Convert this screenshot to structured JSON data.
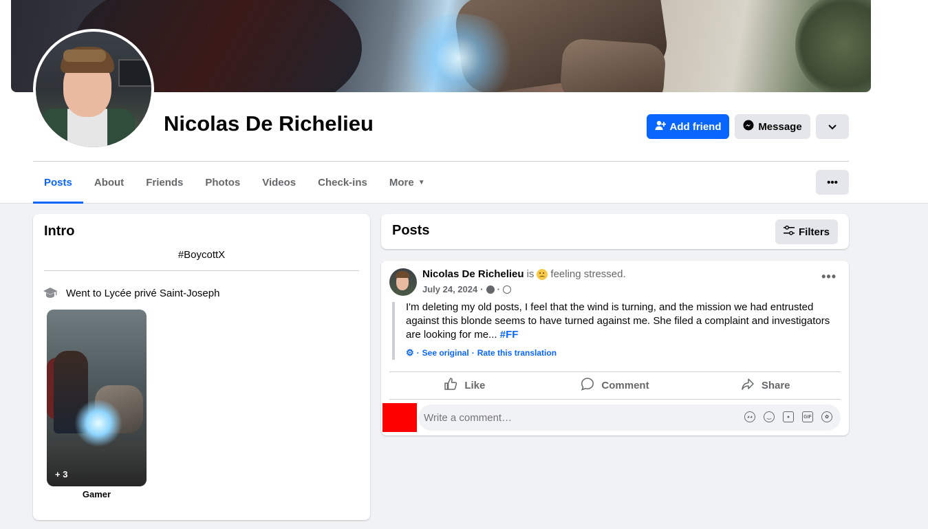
{
  "profile": {
    "name": "Nicolas De Richelieu"
  },
  "header_actions": {
    "add_friend_label": "Add friend",
    "message_label": "Message"
  },
  "tabs": [
    {
      "label": "Posts",
      "active": true
    },
    {
      "label": "About"
    },
    {
      "label": "Friends"
    },
    {
      "label": "Photos"
    },
    {
      "label": "Videos"
    },
    {
      "label": "Check-ins"
    },
    {
      "label": "More"
    }
  ],
  "intro": {
    "title": "Intro",
    "bio": "#BoycottX",
    "education": "Went to Lycée privé Saint-Joseph",
    "featured": {
      "count_label": "+ 3",
      "label": "Gamer"
    }
  },
  "posts_section": {
    "title": "Posts",
    "filters_label": "Filters"
  },
  "post": {
    "author": "Nicolas De Richelieu",
    "is_text": "is",
    "feeling_text": "feeling stressed.",
    "date": "July 24, 2024",
    "sep": "·",
    "text": "I'm deleting my old posts, I feel that the wind is turning, and the mission we had entrusted against this blonde seems to have turned against me. She filed a complaint and investigators are looking for me...",
    "hashtag": "#FF",
    "see_original": "See original",
    "rate_translation": "Rate this translation",
    "actions": {
      "like": "Like",
      "comment": "Comment",
      "share": "Share"
    },
    "comment_placeholder": "Write a comment…"
  },
  "colors": {
    "accent": "#0866ff",
    "background": "#f0f2f5",
    "redacted": "#ff0000"
  }
}
